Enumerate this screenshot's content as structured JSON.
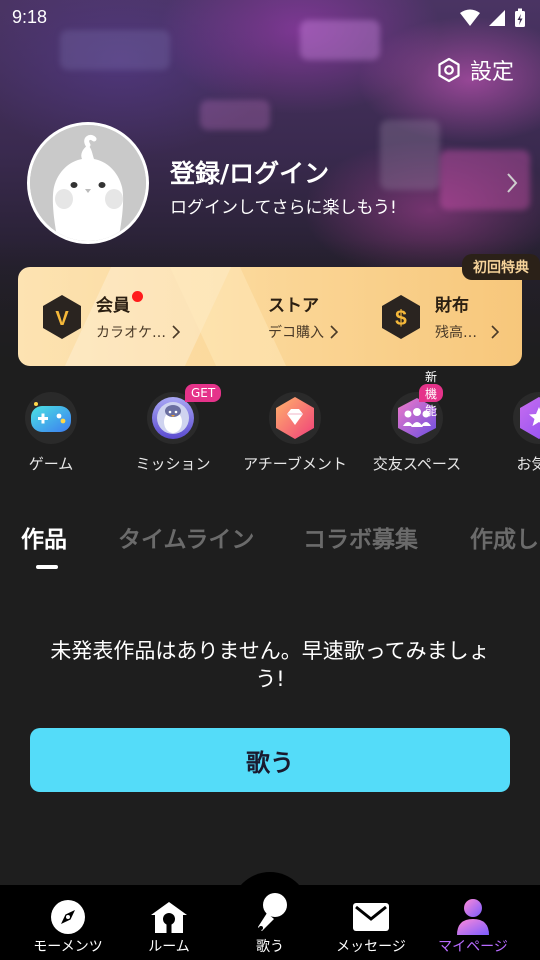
{
  "status_bar": {
    "time": "9:18"
  },
  "settings": {
    "label": "設定"
  },
  "profile": {
    "title": "登録/ログイン",
    "subtitle": "ログインしてさらに楽しもう!"
  },
  "member_card": {
    "promo_badge": "初回特典",
    "items": [
      {
        "title": "会員",
        "subtitle": "カラオケ…"
      },
      {
        "title": "ストア",
        "subtitle": "デコ購入"
      },
      {
        "title": "財布",
        "subtitle": "残高…"
      }
    ]
  },
  "features": [
    {
      "label": "ゲーム",
      "tag": ""
    },
    {
      "label": "ミッション",
      "tag": "GET"
    },
    {
      "label": "アチーブメント",
      "tag": ""
    },
    {
      "label": "交友スペース",
      "tag": "新機能"
    },
    {
      "label": "お気に",
      "tag": ""
    }
  ],
  "tabs": [
    {
      "label": "作品"
    },
    {
      "label": "タイムライン"
    },
    {
      "label": "コラボ募集"
    },
    {
      "label": "作成し"
    }
  ],
  "empty_state": {
    "message": "未発表作品はありません。早速歌ってみましょう!",
    "button_label": "歌う"
  },
  "bottom_nav": [
    {
      "label": "モーメンツ",
      "icon": "compass-icon"
    },
    {
      "label": "ルーム",
      "icon": "house-icon"
    },
    {
      "label": "歌う",
      "icon": "microphone-icon"
    },
    {
      "label": "メッセージ",
      "icon": "envelope-icon"
    },
    {
      "label": "マイページ",
      "icon": "person-icon"
    }
  ],
  "colors": {
    "accent_button": "#54dcf9",
    "active_nav": "#b86bff",
    "tag_pink": "#e5338a",
    "card_gold": "#fbd89a"
  }
}
